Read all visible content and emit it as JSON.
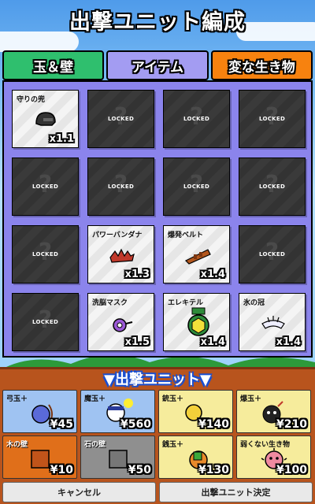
{
  "title": "出撃ユニット編成",
  "tabs": [
    {
      "label": "玉＆壁"
    },
    {
      "label": "アイテム"
    },
    {
      "label": "変な生き物"
    }
  ],
  "items": [
    {
      "name": "守りの兜",
      "multiplier": "x1.1",
      "locked": false,
      "icon": "helmet-icon"
    },
    {
      "locked": true,
      "locked_text": "LOCKED",
      "icon": "question-mark-icon"
    },
    {
      "locked": true,
      "locked_text": "LOCKED",
      "icon": "question-mark-icon"
    },
    {
      "locked": true,
      "locked_text": "LOCKED",
      "icon": "question-mark-icon"
    },
    {
      "locked": true,
      "locked_text": "LOCKED",
      "icon": "question-mark-icon"
    },
    {
      "locked": true,
      "locked_text": "LOCKED",
      "icon": "question-mark-icon"
    },
    {
      "locked": true,
      "locked_text": "LOCKED",
      "icon": "question-mark-icon"
    },
    {
      "locked": true,
      "locked_text": "LOCKED",
      "icon": "question-mark-icon"
    },
    {
      "locked": true,
      "locked_text": "LOCKED",
      "icon": "question-mark-icon"
    },
    {
      "name": "パワーバンダナ",
      "multiplier": "x1.3",
      "locked": false,
      "icon": "bandana-icon"
    },
    {
      "name": "爆発ベルト",
      "multiplier": "x1.4",
      "locked": false,
      "icon": "belt-icon"
    },
    {
      "locked": true,
      "locked_text": "LOCKED",
      "icon": "question-mark-icon"
    },
    {
      "locked": true,
      "locked_text": "LOCKED",
      "icon": "question-mark-icon"
    },
    {
      "name": "洗脳マスク",
      "multiplier": "x1.5",
      "locked": false,
      "icon": "mask-icon"
    },
    {
      "name": "エレキテル",
      "multiplier": "x1.4",
      "locked": false,
      "icon": "elekiter-icon"
    },
    {
      "name": "氷の冠",
      "multiplier": "x1.4",
      "locked": false,
      "icon": "ice-crown-icon"
    }
  ],
  "deploy": {
    "title": "▼出撃ユニット▼"
  },
  "units": [
    {
      "name": "弓玉＋",
      "cost": "¥45",
      "color": "blue",
      "icon": "bow-ball-icon"
    },
    {
      "name": "魔玉＋",
      "cost": "¥560",
      "color": "blue",
      "icon": "magic-ball-icon"
    },
    {
      "name": "銃玉＋",
      "cost": "¥140",
      "color": "yellow",
      "icon": "gun-ball-icon"
    },
    {
      "name": "爆玉＋",
      "cost": "¥210",
      "color": "yellow",
      "icon": "bomb-ball-icon"
    },
    {
      "name": "木の壁",
      "cost": "¥10",
      "color": "orange",
      "icon": "wood-wall-icon"
    },
    {
      "name": "石の壁",
      "cost": "¥50",
      "color": "gray",
      "icon": "stone-wall-icon"
    },
    {
      "name": "銭玉＋",
      "cost": "¥130",
      "color": "yellow",
      "icon": "coin-ball-icon"
    },
    {
      "name": "弱くない生き物",
      "cost": "¥100",
      "color": "yellow",
      "icon": "pink-creature-icon"
    }
  ],
  "buttons": {
    "cancel": "キャンセル",
    "confirm": "出撃ユニット決定"
  }
}
